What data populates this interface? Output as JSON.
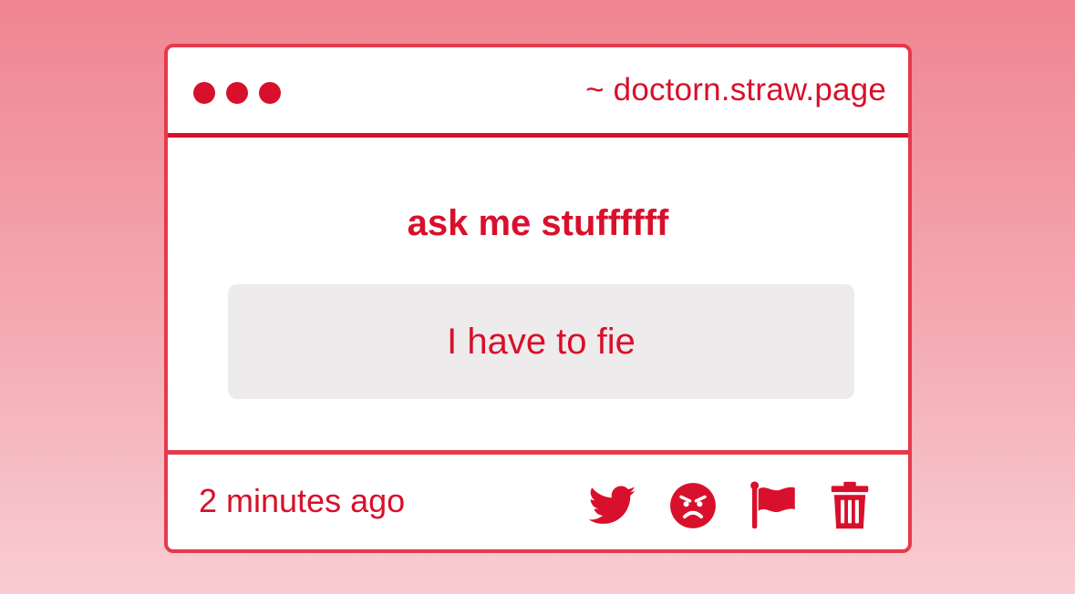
{
  "window": {
    "url": "~ doctorn.straw.page"
  },
  "main": {
    "heading": "ask me stuffffff",
    "question": "I have to fie"
  },
  "footer": {
    "timestamp": "2 minutes ago",
    "actions": [
      {
        "icon": "twitter-icon"
      },
      {
        "icon": "angry-face-icon"
      },
      {
        "icon": "flag-icon"
      },
      {
        "icon": "trash-icon"
      }
    ]
  },
  "colors": {
    "accent": "#d8102b",
    "border": "#e43a4c",
    "question_bg": "#edebeb",
    "page_bg_top": "#ef8591",
    "page_bg_bottom": "#f8cdd2"
  }
}
